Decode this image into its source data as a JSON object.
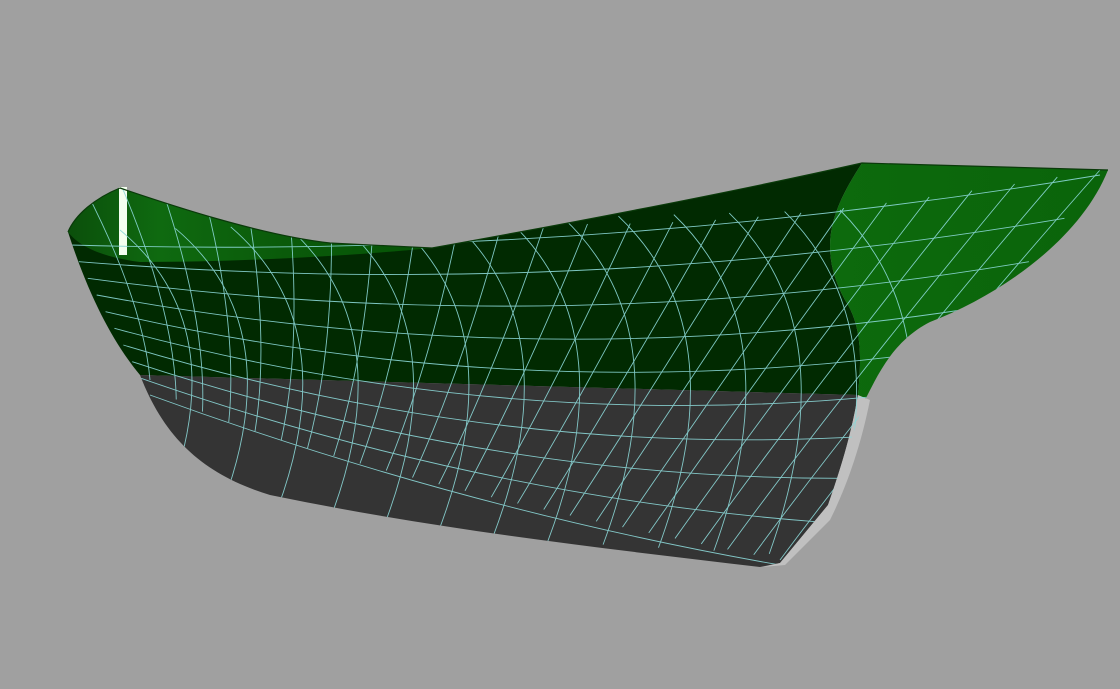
{
  "viewport": {
    "background_color": "#a0a0a0",
    "render_mode": "shaded-with-mesh"
  },
  "model": {
    "object": "boat-hull",
    "colors": {
      "inner_hull_green": "#075f07",
      "outer_hull_dark_green": "#012a01",
      "below_waterline_gray": "#343434",
      "transom_edge_gray": "#c0c0c0",
      "highlight_white": "#f4fff0",
      "mesh_lines_cyan": "#8cd8d8"
    },
    "mesh": {
      "station_lines": 24,
      "waterlines": 9
    }
  }
}
